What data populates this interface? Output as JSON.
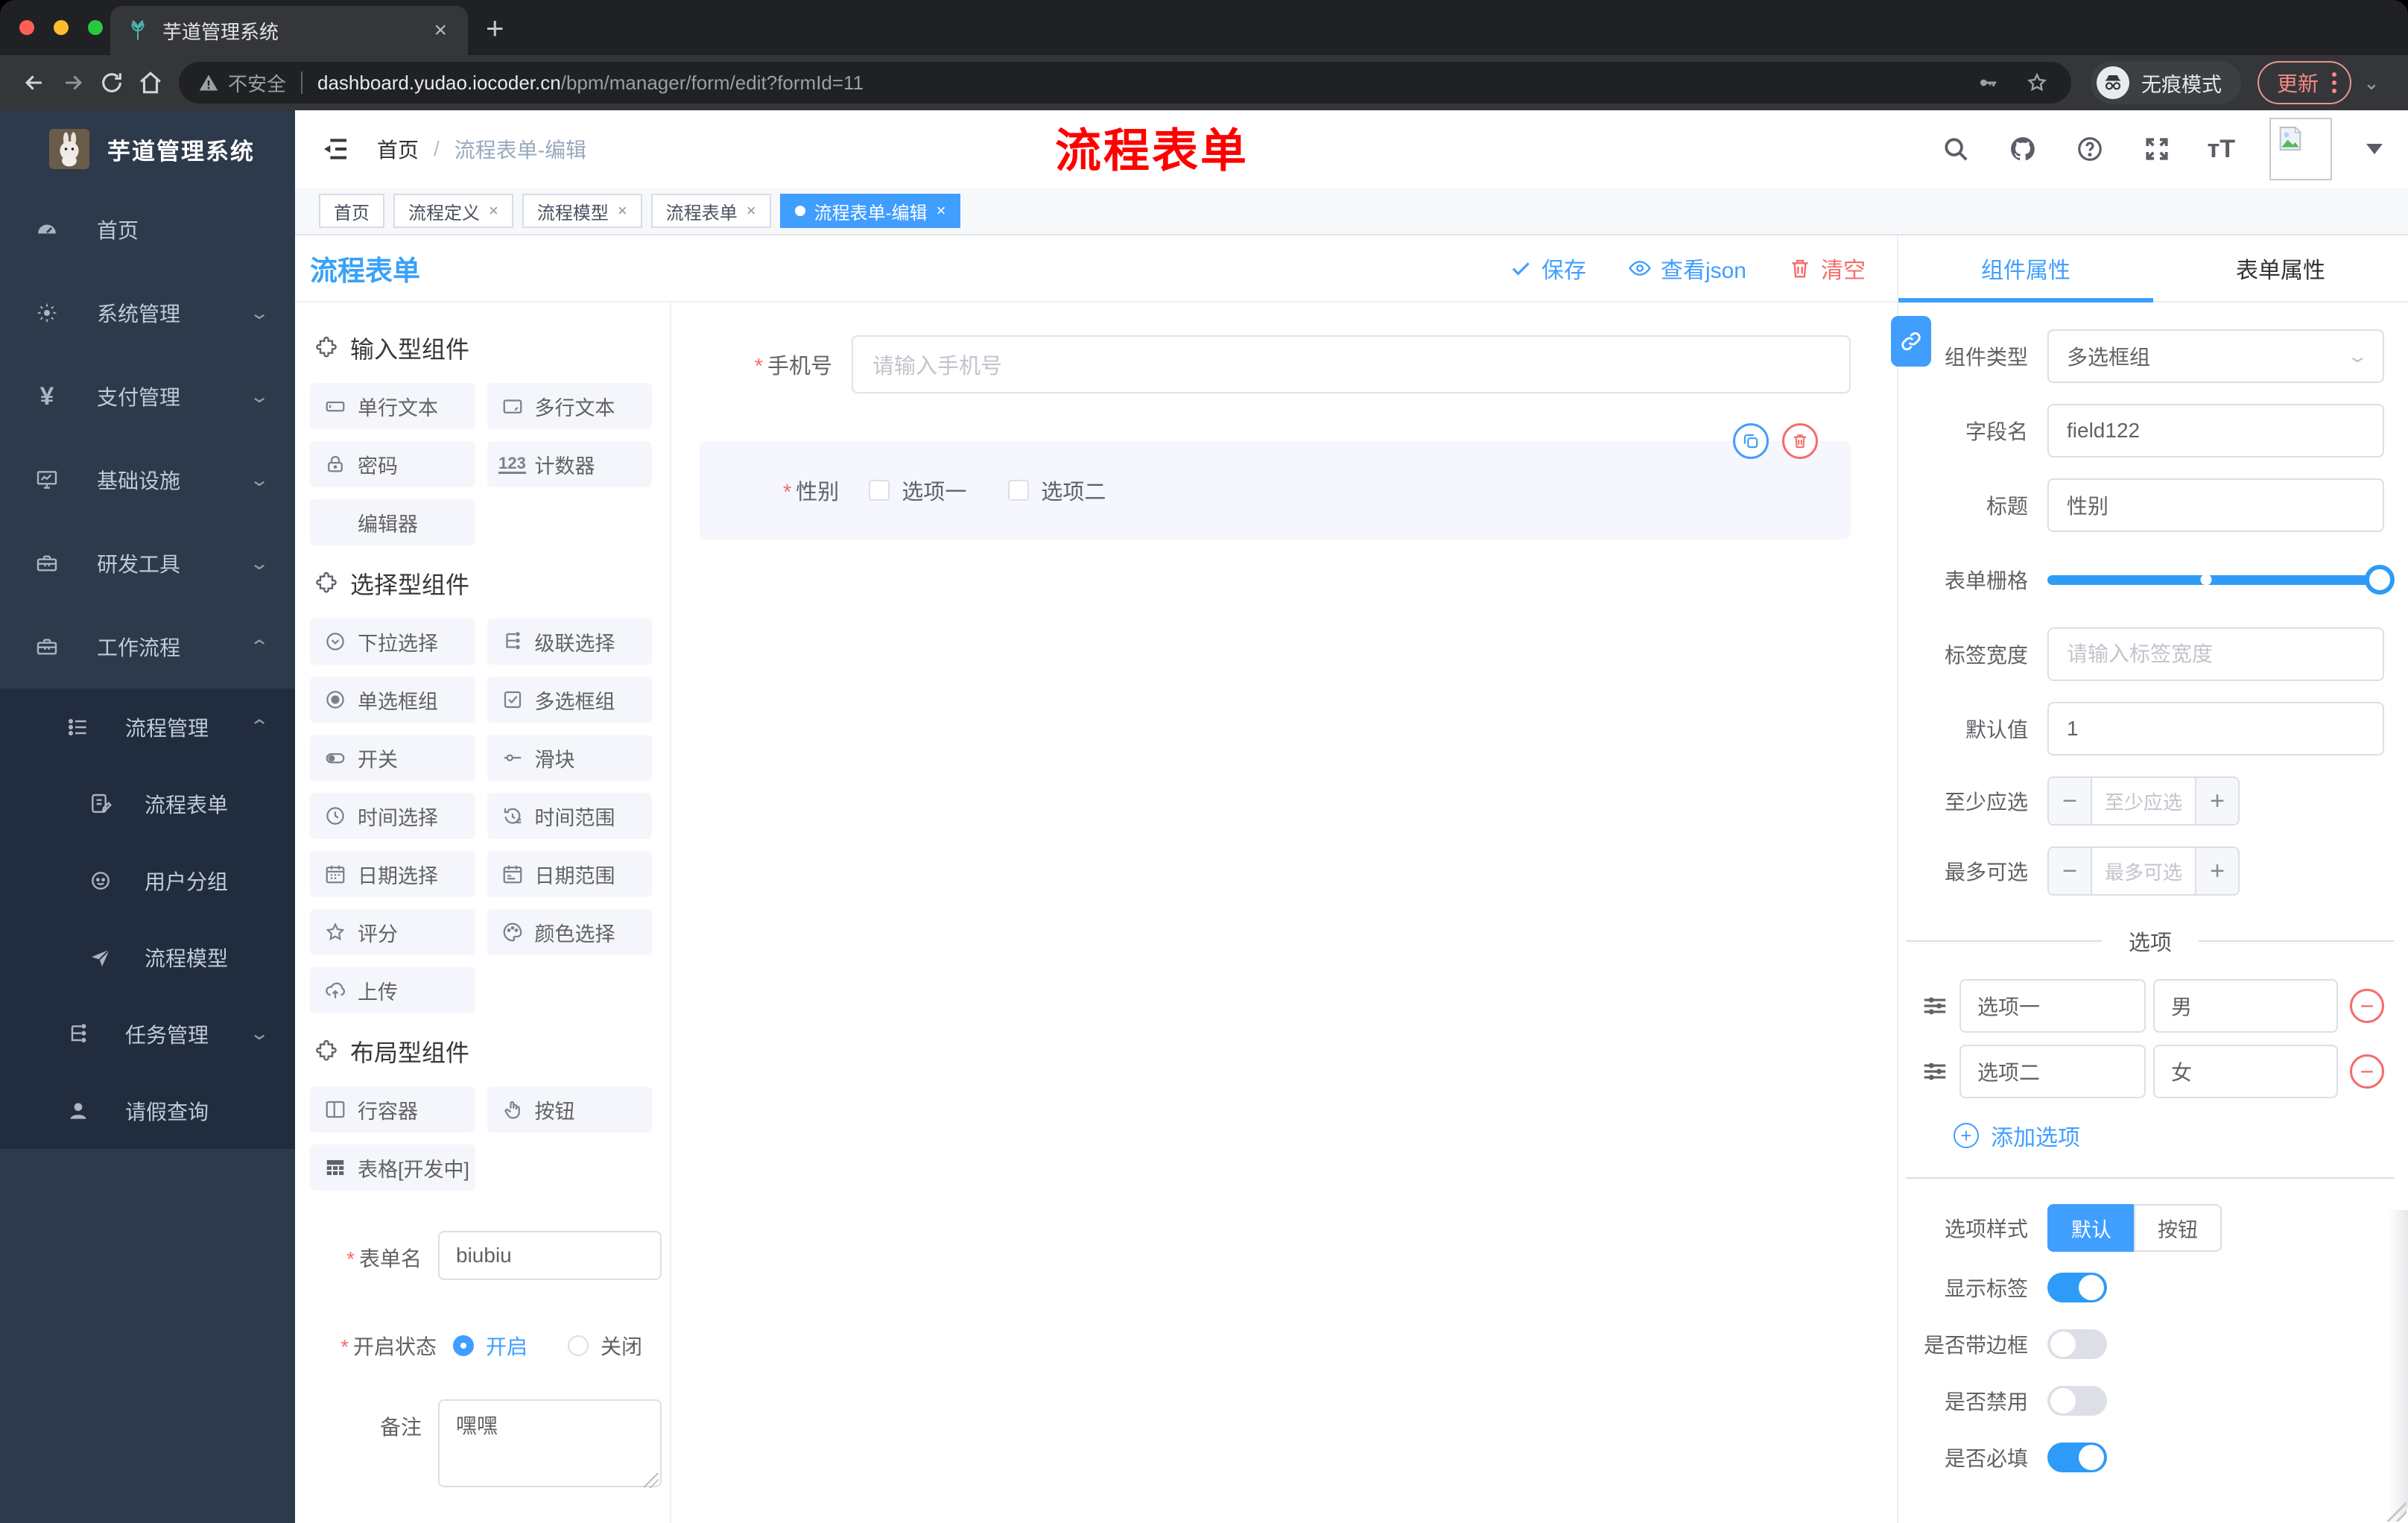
{
  "browser": {
    "tab_title": "芋道管理系统",
    "close_tab": "×",
    "new_tab": "+",
    "security": "不安全",
    "url_host": "dashboard.yudao.iocoder.cn",
    "url_path": "/bpm/manager/form/edit?formId=11",
    "incognito_label": "无痕模式",
    "update_label": "更新",
    "traffic_colors": {
      "red": "#ff5f57",
      "yellow": "#febc2e",
      "green": "#28c840"
    }
  },
  "sidebar": {
    "logo_title": "芋道管理系统",
    "items": [
      "首页",
      "系统管理",
      "支付管理",
      "基础设施",
      "研发工具",
      "工作流程",
      "流程管理",
      "流程表单",
      "用户分组",
      "流程模型",
      "任务管理",
      "请假查询"
    ]
  },
  "header": {
    "breadcrumb_home": "首页",
    "breadcrumb_sep": "/",
    "breadcrumb_current": "流程表单-编辑",
    "overlay_title": "流程表单"
  },
  "tags": {
    "items": [
      "首页",
      "流程定义",
      "流程模型",
      "流程表单",
      "流程表单-编辑"
    ]
  },
  "toolbar": {
    "title": "流程表单",
    "save": "保存",
    "view_json": "查看json",
    "clear": "清空"
  },
  "palette": {
    "sections": [
      {
        "title": "输入型组件",
        "items": [
          "单行文本",
          "多行文本",
          "密码",
          "计数器",
          "编辑器"
        ]
      },
      {
        "title": "选择型组件",
        "items": [
          "下拉选择",
          "级联选择",
          "单选框组",
          "多选框组",
          "开关",
          "滑块",
          "时间选择",
          "时间范围",
          "日期选择",
          "日期范围",
          "评分",
          "颜色选择",
          "上传"
        ]
      },
      {
        "title": "布局型组件",
        "items": [
          "行容器",
          "按钮",
          "表格[开发中]"
        ]
      }
    ]
  },
  "left_form": {
    "name_label": "表单名",
    "name_value": "biubiu",
    "status_label": "开启状态",
    "status_on": "开启",
    "status_off": "关闭",
    "remark_label": "备注",
    "remark_value": "嘿嘿"
  },
  "canvas": {
    "phone_label": "手机号",
    "phone_placeholder": "请输入手机号",
    "gender_label": "性别",
    "option1": "选项一",
    "option2": "选项二"
  },
  "inspector": {
    "tab_component": "组件属性",
    "tab_form": "表单属性",
    "type_label": "组件类型",
    "type_value": "多选框组",
    "field_label": "字段名",
    "field_value": "field122",
    "title_label": "标题",
    "title_value": "性别",
    "grid_label": "表单栅格",
    "width_label": "标签宽度",
    "width_placeholder": "请输入标签宽度",
    "default_label": "默认值",
    "default_value": "1",
    "min_label": "至少应选",
    "min_placeholder": "至少应选",
    "max_label": "最多可选",
    "max_placeholder": "最多可选",
    "minus": "−",
    "plus": "+",
    "options_header": "选项",
    "options": [
      {
        "label": "选项一",
        "value": "男"
      },
      {
        "label": "选项二",
        "value": "女"
      }
    ],
    "add_option": "添加选项",
    "style_label": "选项样式",
    "style_default": "默认",
    "style_button": "按钮",
    "switch_show_label": "显示标签",
    "switch_border": "是否带边框",
    "switch_disabled": "是否禁用",
    "switch_required": "是否必填"
  },
  "colors": {
    "accent": "#409eff",
    "danger": "#f56c6c",
    "overlay_red": "#fe0000",
    "sidebar_bg": "#2d3a4b",
    "submenu_bg": "#212c3e",
    "chrome_bg": "#202124",
    "navbar_bg": "#35363a"
  }
}
